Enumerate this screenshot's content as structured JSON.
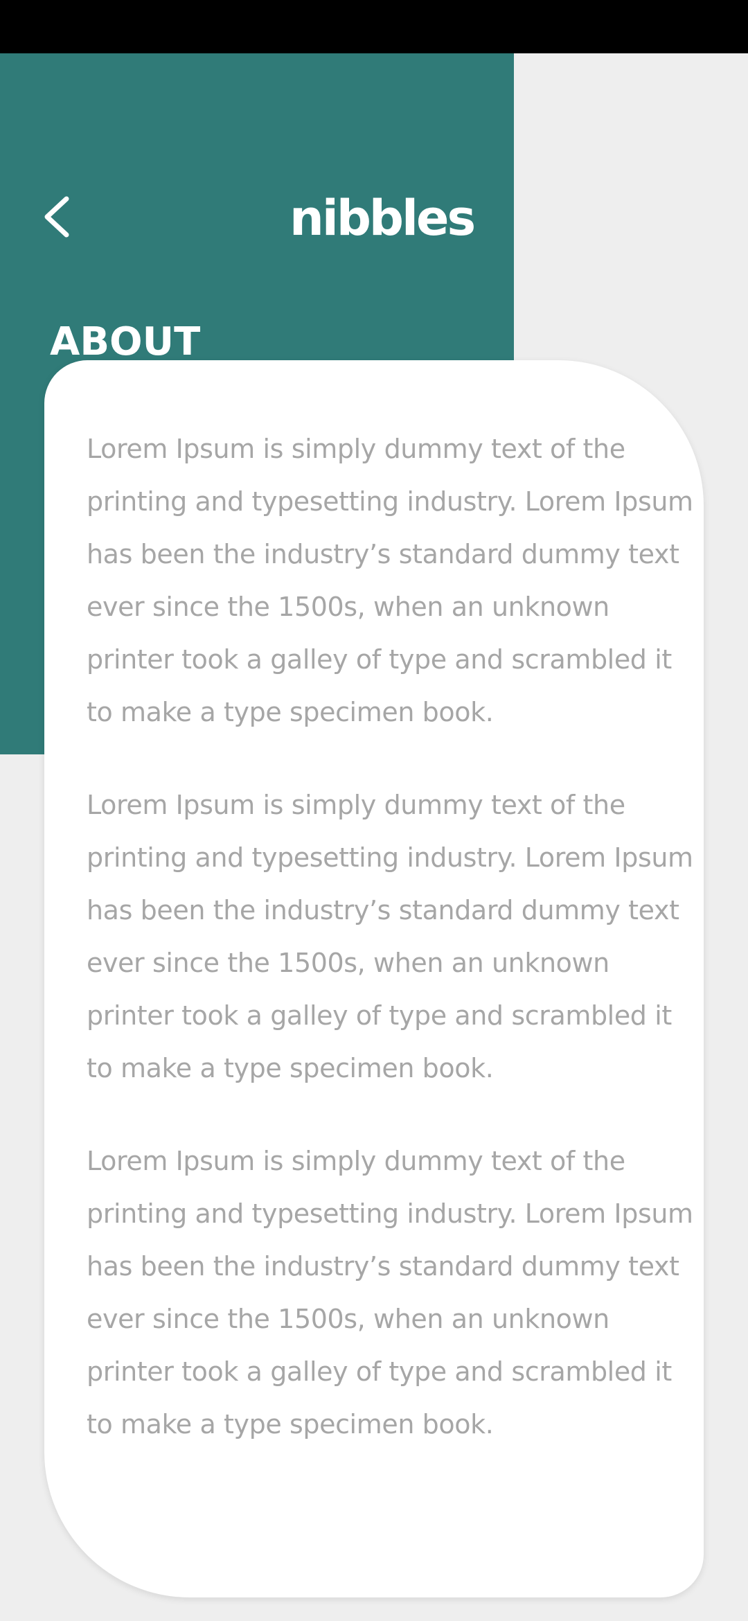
{
  "header": {
    "logo_text": "nibbles",
    "back_icon": "chevron-left-icon",
    "title": "ABOUT"
  },
  "content": {
    "paragraphs": [
      "Lorem Ipsum is simply dummy text of the printing and typesetting industry. Lorem Ipsum has been the industry’s standard dummy text ever since the 1500s, when an unknown printer took a galley of type and scrambled it to make a type specimen book.",
      "Lorem Ipsum is simply dummy text of the printing and typesetting industry. Lorem Ipsum has been the industry’s standard dummy text ever since the 1500s, when an unknown printer took a galley of type and scrambled it to make a type specimen book.",
      "Lorem Ipsum is simply dummy text of the printing and typesetting industry. Lorem Ipsum has been the industry’s standard dummy text ever since the 1500s, when an unknown printer took a galley of type and scrambled it to make a type specimen book."
    ]
  },
  "colors": {
    "brand_teal": "#307b78",
    "background": "#eeeeee",
    "status_bar": "#000000",
    "card": "#ffffff",
    "body_text": "#a6a6a6",
    "header_text": "#ffffff"
  }
}
